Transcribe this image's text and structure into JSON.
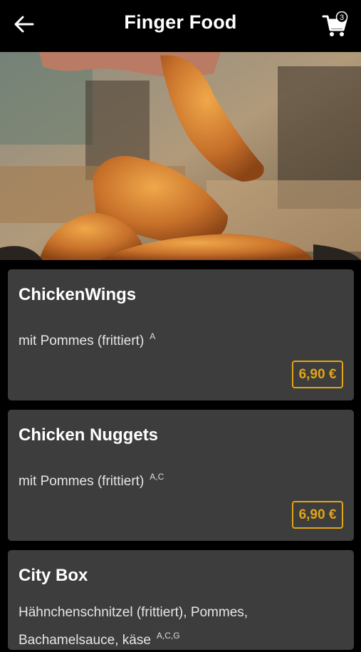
{
  "header": {
    "title": "Finger Food",
    "cart_count": "3"
  },
  "hero": {
    "image": "fried-chicken-strips-photo"
  },
  "items": [
    {
      "name": "ChickenWings",
      "description": "mit Pommes (frittiert)",
      "allergens": "A",
      "price": "6,90 €"
    },
    {
      "name": "Chicken Nuggets",
      "description": "mit Pommes (frittiert)",
      "allergens": "A,C",
      "price": "6,90 €"
    },
    {
      "name": "City Box",
      "description_line1": "Hähnchenschnitzel (frittiert), Pommes,",
      "description_line2": "Bachamelsauce, käse",
      "allergens": "A,C,G"
    }
  ],
  "colors": {
    "accent": "#e3a514",
    "card": "#3d3d3d",
    "background": "#000000"
  }
}
